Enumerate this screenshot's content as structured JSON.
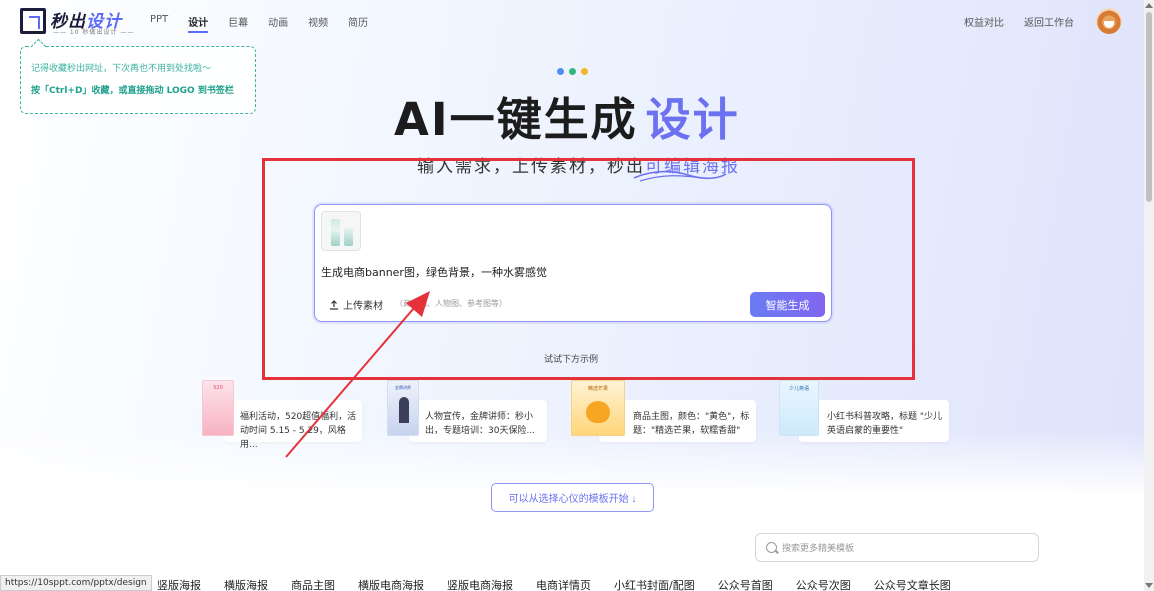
{
  "header": {
    "logo_main_a": "秒出",
    "logo_main_b": "设计",
    "logo_sub": "—— 10 秒做出设计 ——",
    "nav": [
      "PPT",
      "设计",
      "巨幕",
      "动画",
      "视频",
      "简历"
    ],
    "nav_active": "设计",
    "right_nav": [
      "权益对比",
      "返回工作台"
    ]
  },
  "tip": {
    "line1": "记得收藏秒出网址，下次再也不用到处找啦～",
    "line2": "按「Ctrl+D」收藏，或直接拖动 LOGO 到书签栏"
  },
  "hero": {
    "title": "AI一键生成",
    "title_highlight": "设计",
    "subtitle": "输入需求，上传素材，秒出",
    "subtitle_highlight": "可编辑海报"
  },
  "input": {
    "prompt": "生成电商banner图，绿色背景，一种水雾感觉",
    "upload_label": "上传素材",
    "upload_hint": "（商品图、人物图、参考图等）",
    "generate_label": "智能生成"
  },
  "try_label": "试试下方示例",
  "examples": [
    {
      "thumb_title": "520",
      "text": "福利活动，520超值福利，活动时间 5.15 - 5.29，风格用..."
    },
    {
      "thumb_title": "金牌讲师",
      "text": "人物宣传，金牌讲师：秒小出，专题培训：30天保险..."
    },
    {
      "thumb_title": "精选芒果",
      "text": "商品主图，颜色：\"黄色\"，标题：\"精选芒果，软糯香甜\""
    },
    {
      "thumb_title": "少儿英语",
      "text": "小红书科普攻略，标题 \"少儿英语启蒙的重要性\""
    }
  ],
  "template_button": "可以从选择心仪的模板开始 ↓",
  "search": {
    "placeholder": "搜索更多精美模板"
  },
  "categories": [
    "竖版海报",
    "横版海报",
    "商品主图",
    "横版电商海报",
    "竖版电商海报",
    "电商详情页",
    "小红书封面/配图",
    "公众号首图",
    "公众号次图",
    "公众号文章长图"
  ],
  "status_url": "https://10sppt.com/pptx/design",
  "colors": {
    "accent": "#6b71f0",
    "annotation": "#e5323a",
    "tip": "#3bb29f"
  }
}
